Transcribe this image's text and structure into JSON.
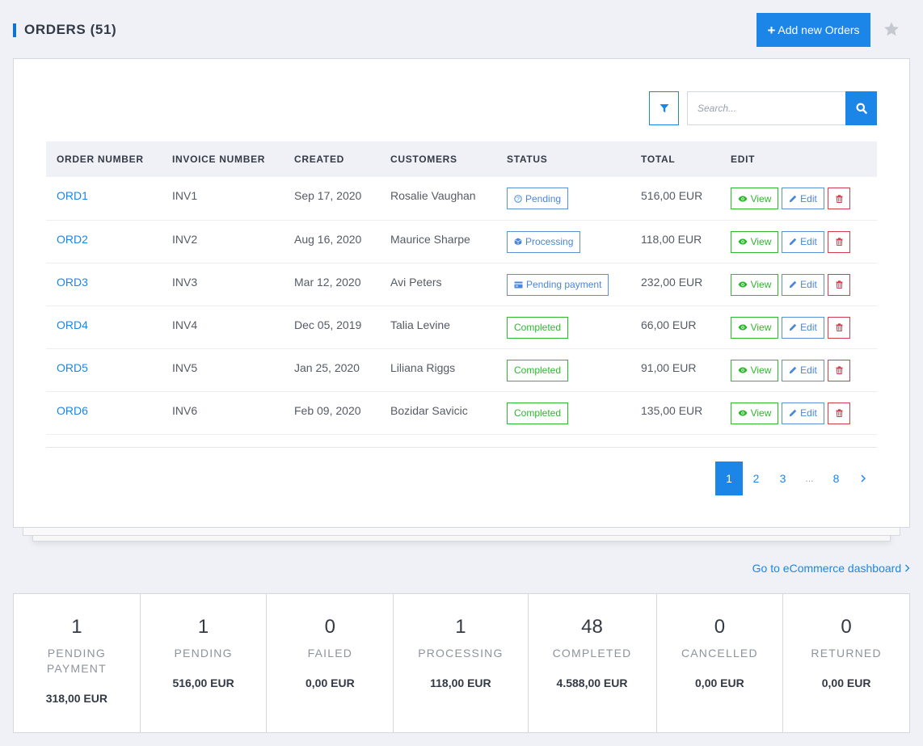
{
  "header": {
    "title": "ORDERS (51)",
    "add_button_label": "Add new Orders",
    "add_button_icon": "plus-icon",
    "favorite_icon": "star-icon"
  },
  "toolbar": {
    "filter_icon": "filter-icon",
    "search_placeholder": "Search...",
    "search_value": "",
    "search_icon": "search-icon"
  },
  "table": {
    "columns": [
      "ORDER NUMBER",
      "INVOICE NUMBER",
      "CREATED",
      "CUSTOMERS",
      "STATUS",
      "TOTAL",
      "EDIT"
    ],
    "rows": [
      {
        "order": "ORD1",
        "invoice": "INV1",
        "created": "Sep 17, 2020",
        "customer": "Rosalie Vaughan",
        "status": "Pending",
        "status_icon": "question-circle-icon",
        "status_color": "blue",
        "total": "516,00 EUR"
      },
      {
        "order": "ORD2",
        "invoice": "INV2",
        "created": "Aug 16, 2020",
        "customer": "Maurice Sharpe",
        "status": "Processing",
        "status_icon": "cube-icon",
        "status_color": "blue",
        "total": "118,00 EUR"
      },
      {
        "order": "ORD3",
        "invoice": "INV3",
        "created": "Mar 12, 2020",
        "customer": "Avi Peters",
        "status": "Pending payment",
        "status_icon": "credit-card-icon",
        "status_color": "blue",
        "total": "232,00 EUR"
      },
      {
        "order": "ORD4",
        "invoice": "INV4",
        "created": "Dec 05, 2019",
        "customer": "Talia Levine",
        "status": "Completed",
        "status_icon": "",
        "status_color": "green",
        "total": "66,00 EUR"
      },
      {
        "order": "ORD5",
        "invoice": "INV5",
        "created": "Jan 25, 2020",
        "customer": "Liliana Riggs",
        "status": "Completed",
        "status_icon": "",
        "status_color": "green",
        "total": "91,00 EUR"
      },
      {
        "order": "ORD6",
        "invoice": "INV6",
        "created": "Feb 09, 2020",
        "customer": "Bozidar Savicic",
        "status": "Completed",
        "status_icon": "",
        "status_color": "green",
        "total": "135,00 EUR"
      }
    ],
    "actions": {
      "view_label": "View",
      "edit_label": "Edit",
      "delete_icon": "trash-icon"
    }
  },
  "pagination": {
    "pages": [
      "1",
      "2",
      "3",
      "...",
      "8"
    ],
    "current": "1",
    "next_icon": "chevron-right-icon"
  },
  "dashboard_link": "Go to eCommerce dashboard",
  "stats": [
    {
      "count": "1",
      "label": "PENDING PAYMENT",
      "amount": "318,00 EUR"
    },
    {
      "count": "1",
      "label": "PENDING",
      "amount": "516,00 EUR"
    },
    {
      "count": "0",
      "label": "FAILED",
      "amount": "0,00 EUR"
    },
    {
      "count": "1",
      "label": "PROCESSING",
      "amount": "118,00 EUR"
    },
    {
      "count": "48",
      "label": "COMPLETED",
      "amount": "4.588,00 EUR"
    },
    {
      "count": "0",
      "label": "CANCELLED",
      "amount": "0,00 EUR"
    },
    {
      "count": "0",
      "label": "RETURNED",
      "amount": "0,00 EUR"
    }
  ],
  "colors": {
    "primary": "#1b86e8",
    "title_accent": "#0f75d3",
    "status_blue": "#4b86d8",
    "status_green": "#2eb82e",
    "danger": "#d23f4c",
    "background": "#eff1f6"
  }
}
